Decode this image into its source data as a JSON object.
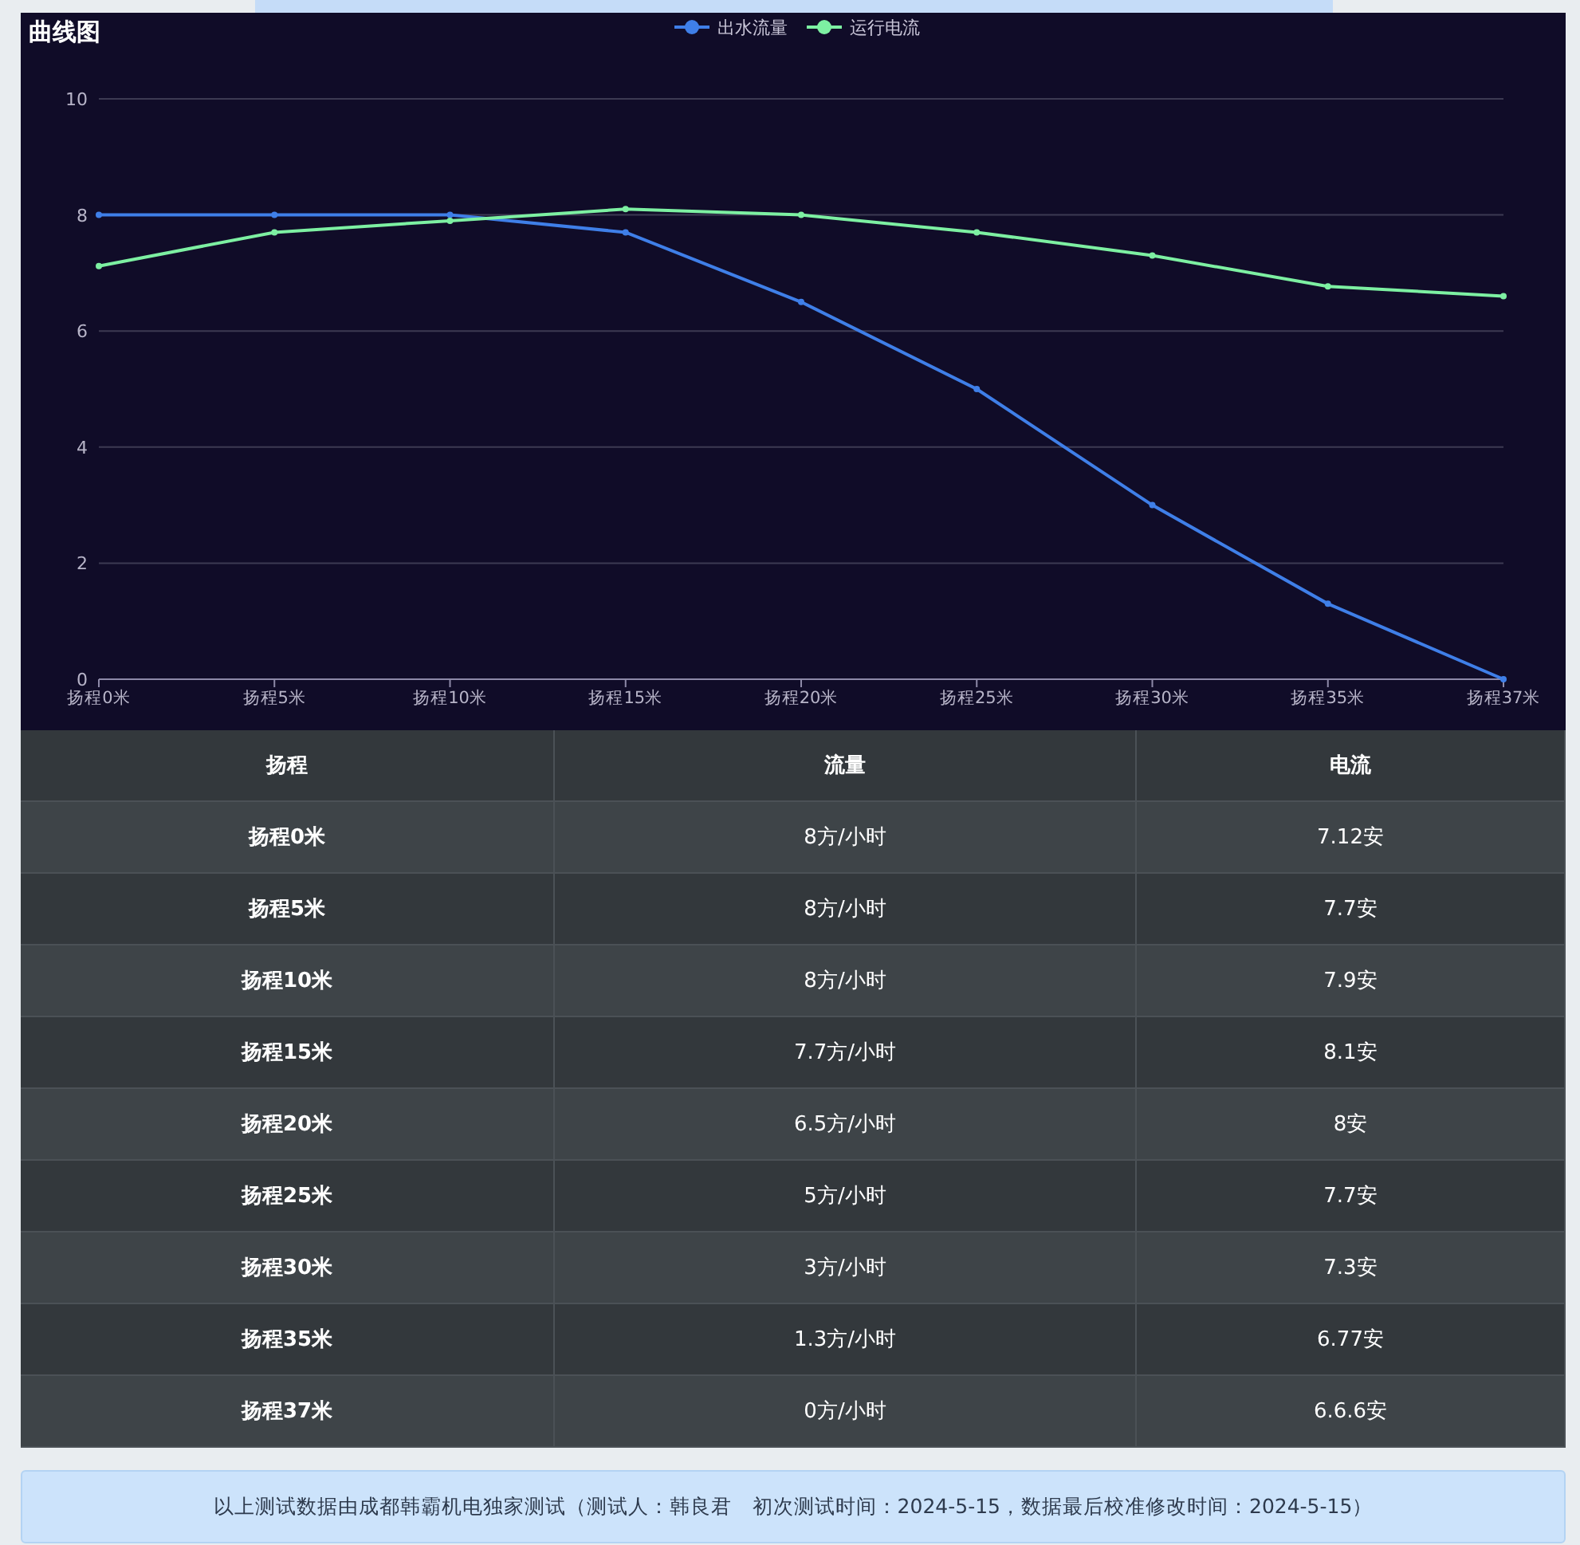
{
  "chart": {
    "title": "曲线图",
    "chart_data": {
      "type": "line",
      "categories": [
        "扬程0米",
        "扬程5米",
        "扬程10米",
        "扬程15米",
        "扬程20米",
        "扬程25米",
        "扬程30米",
        "扬程35米",
        "扬程37米"
      ],
      "ylim": [
        0,
        10
      ],
      "grid": true,
      "legend": true,
      "yticks": [
        0,
        2,
        4,
        6,
        8,
        10
      ],
      "series": [
        {
          "name": "出水流量",
          "color": "#3f7fe8",
          "marker": "circle",
          "values": [
            8,
            8,
            8,
            7.7,
            6.5,
            5,
            3,
            1.3,
            0
          ]
        },
        {
          "name": "运行电流",
          "color": "#7df0a2",
          "marker": "circle",
          "values": [
            7.12,
            7.7,
            7.9,
            8.1,
            8,
            7.7,
            7.3,
            6.77,
            6.6
          ]
        }
      ]
    }
  },
  "table": {
    "columns": [
      "扬程",
      "流量",
      "电流"
    ],
    "rows": [
      [
        "扬程0米",
        "8方/小时",
        "7.12安"
      ],
      [
        "扬程5米",
        "8方/小时",
        "7.7安"
      ],
      [
        "扬程10米",
        "8方/小时",
        "7.9安"
      ],
      [
        "扬程15米",
        "7.7方/小时",
        "8.1安"
      ],
      [
        "扬程20米",
        "6.5方/小时",
        "8安"
      ],
      [
        "扬程25米",
        "5方/小时",
        "7.7安"
      ],
      [
        "扬程30米",
        "3方/小时",
        "7.3安"
      ],
      [
        "扬程35米",
        "1.3方/小时",
        "6.77安"
      ],
      [
        "扬程37米",
        "0方/小时",
        "6.6.6安"
      ]
    ]
  },
  "footer": {
    "note": "以上测试数据由成都韩霸机电独家测试（测试人：韩良君　初次测试时间：2024-5-15，数据最后校准修改时间：2024-5-15）"
  }
}
